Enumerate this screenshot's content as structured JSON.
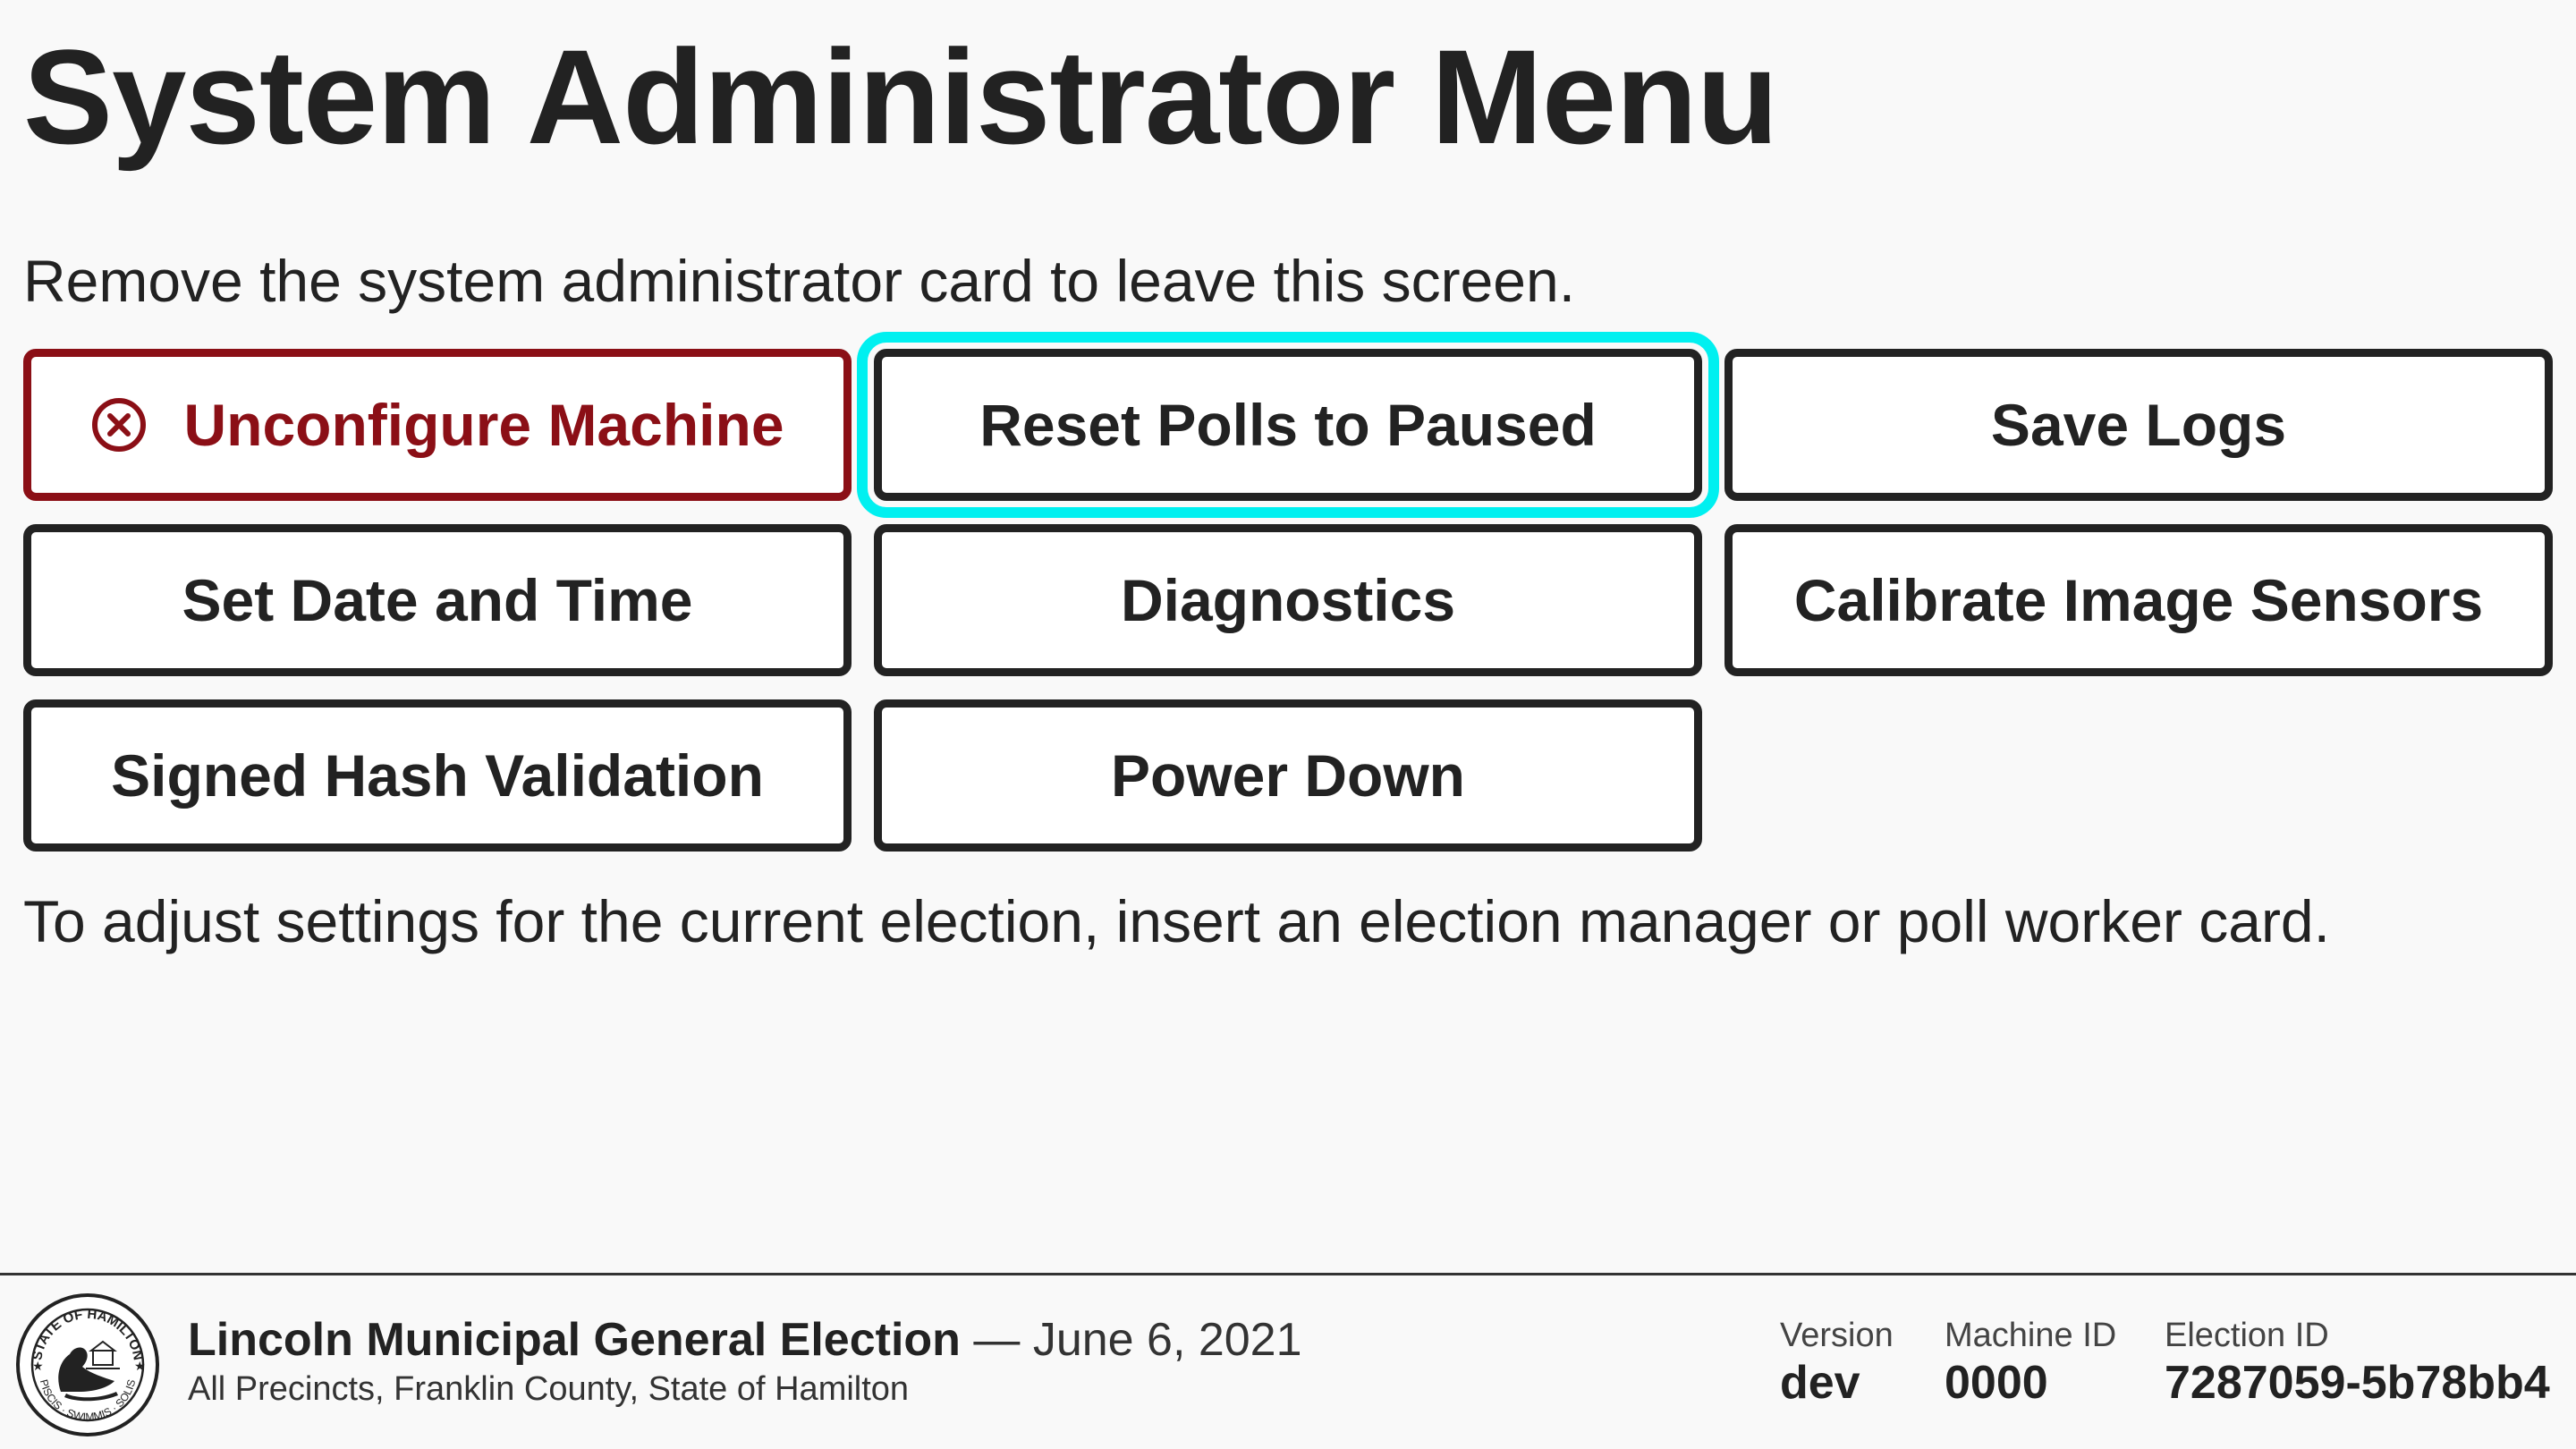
{
  "header": {
    "title": "System Administrator Menu"
  },
  "instructions": {
    "remove_card": "Remove the system administrator card to leave this screen.",
    "adjust_settings": "To adjust settings for the current election, insert an election manager or poll worker card."
  },
  "buttons": {
    "unconfigure": "Unconfigure Machine",
    "reset_polls": "Reset Polls to Paused",
    "save_logs": "Save Logs",
    "set_date_time": "Set Date and Time",
    "diagnostics": "Diagnostics",
    "calibrate": "Calibrate Image Sensors",
    "signed_hash": "Signed Hash Validation",
    "power_down": "Power Down"
  },
  "footer": {
    "election_name": "Lincoln Municipal General Election",
    "election_date": " — June 6, 2021",
    "election_subtitle": "All Precincts, Franklin County, State of Hamilton",
    "seal_text_top": "STATE OF HAMILTON",
    "seal_text_bottom": "PISCIS · SWIMMIS · SOLIS",
    "version_label": "Version",
    "version_value": "dev",
    "machine_id_label": "Machine ID",
    "machine_id_value": "0000",
    "election_id_label": "Election ID",
    "election_id_value": "7287059-5b78bb4"
  },
  "colors": {
    "background": "#f9f9f9",
    "text": "#222222",
    "danger": "#8b0f16",
    "focus_ring": "#00f0f0"
  },
  "icons": {
    "unconfigure": "circle-x-icon",
    "seal": "state-seal-logo"
  }
}
